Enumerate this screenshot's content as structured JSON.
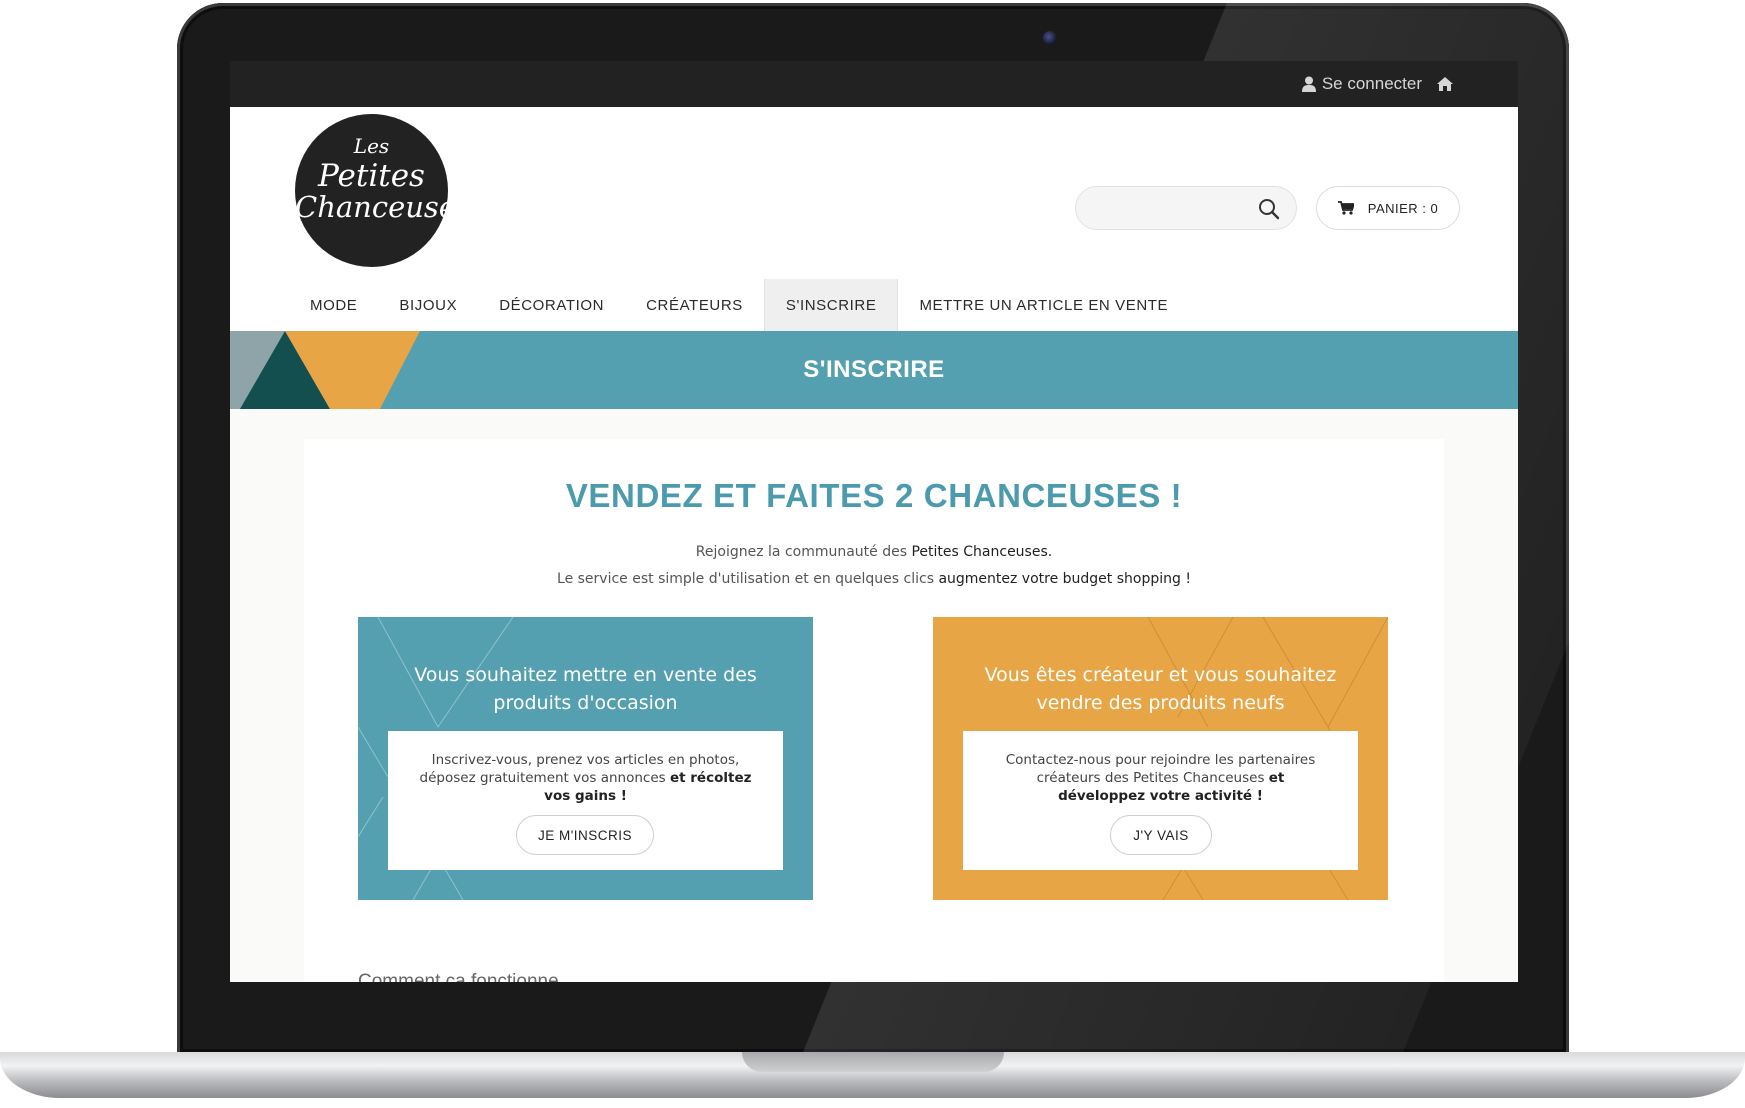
{
  "topbar": {
    "login_label": "Se connecter"
  },
  "logo": {
    "line1": "Les",
    "line2": "Petites",
    "line3": "Chanceuses"
  },
  "search": {
    "placeholder": "",
    "icon": "search-icon"
  },
  "cart": {
    "label": "PANIER : 0",
    "icon": "cart-icon"
  },
  "nav": {
    "items": [
      {
        "label": "MODE"
      },
      {
        "label": "BIJOUX"
      },
      {
        "label": "DÉCORATION"
      },
      {
        "label": "CRÉATEURS"
      },
      {
        "label": "S'INSCRIRE",
        "active": true
      },
      {
        "label": "METTRE UN ARTICLE EN VENTE"
      }
    ]
  },
  "banner": {
    "title": "S'INSCRIRE"
  },
  "main": {
    "headline": "VENDEZ ET FAITES 2 CHANCEUSES !",
    "intro_line1_plain": "Rejoignez la communauté des ",
    "intro_line1_bold": "Petites Chanceuses.",
    "intro_line2_plain": "Le service est simple d'utilisation et en quelques clics ",
    "intro_line2_bold": "augmentez votre budget shopping !",
    "cards": [
      {
        "title_line1": "Vous souhaitez mettre en vente des",
        "title_line2": "produits d'occasion",
        "text_line1": "Inscrivez-vous, prenez vos articles en photos,",
        "text_line2_plain": "déposez gratuitement vos annonces ",
        "text_line2_bold": "et récoltez",
        "text_line3_bold": "vos gains !",
        "button": "JE M'INSCRIS"
      },
      {
        "title_line1": "Vous êtes créateur et vous souhaitez",
        "title_line2": "vendre des produits neufs",
        "text_line1": "Contactez-nous pour rejoindre les partenaires",
        "text_line2_plain": "créateurs des Petites Chanceuses ",
        "text_line2_bold": "et",
        "text_line3_bold": "développez votre activité !",
        "button": "J'Y VAIS"
      }
    ],
    "how_title": "Comment ça fonctionne"
  },
  "colors": {
    "teal": "#54a0b0",
    "orange": "#e8a545",
    "dark_teal": "#144f50",
    "topbar": "#222222"
  }
}
